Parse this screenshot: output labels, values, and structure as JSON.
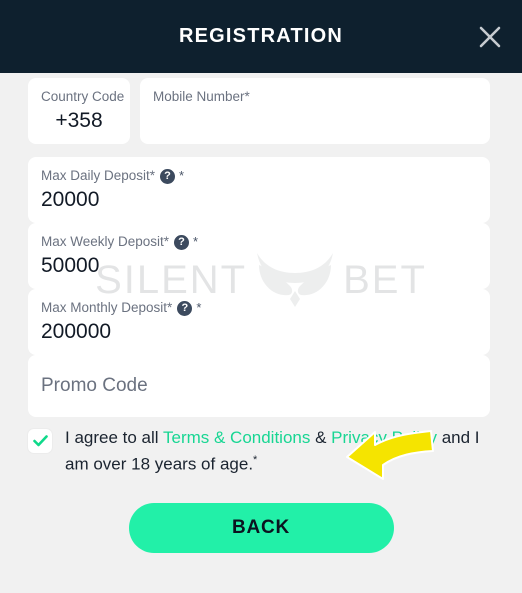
{
  "header": {
    "title": "REGISTRATION",
    "close_icon": "close-icon"
  },
  "form": {
    "country_code": {
      "label": "Country Code",
      "value": "+358"
    },
    "mobile_number": {
      "label": "Mobile Number*",
      "value": ""
    },
    "max_daily_deposit": {
      "label": "Max Daily Deposit*",
      "help_icon": "question-mark-icon",
      "required_mark": "*",
      "value": "20000"
    },
    "max_weekly_deposit": {
      "label": "Max Weekly Deposit*",
      "help_icon": "question-mark-icon",
      "required_mark": "*",
      "value": "50000"
    },
    "max_monthly_deposit": {
      "label": "Max Monthly Deposit*",
      "help_icon": "question-mark-icon",
      "required_mark": "*",
      "value": "200000"
    },
    "promo_code": {
      "placeholder": "Promo Code",
      "value": ""
    }
  },
  "terms": {
    "checked": true,
    "text_before": "I agree to all ",
    "link_terms": "Terms & Conditions",
    "text_middle": " & ",
    "link_privacy": "Privacy Policy",
    "text_after": " and I am over 18 years of age.",
    "required_mark": "*"
  },
  "actions": {
    "back_label": "BACK"
  },
  "watermark": {
    "text_left": "SILENT",
    "text_right": "BET",
    "logo_icon": "owl-logo-icon"
  },
  "annotation": {
    "arrow_icon": "arrow-pointing-left-icon"
  },
  "colors": {
    "header_bg": "#0e202e",
    "page_bg": "#f1f1f1",
    "accent_green": "#22f0a8",
    "link_green": "#18d693",
    "arrow_yellow": "#f5e400"
  }
}
